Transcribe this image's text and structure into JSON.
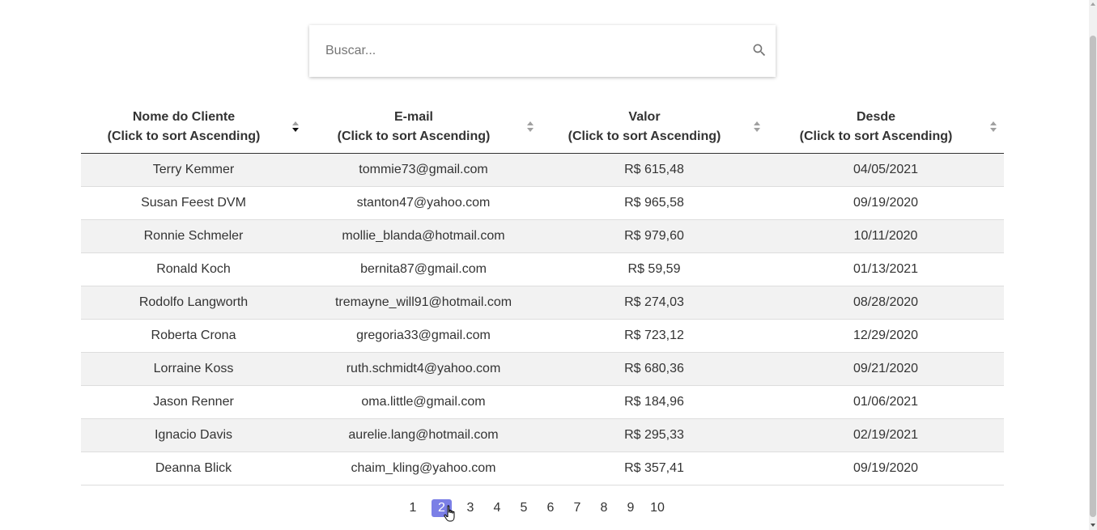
{
  "search": {
    "placeholder": "Buscar...",
    "icon": "search-icon"
  },
  "table": {
    "headers": [
      {
        "title": "Nome do Cliente",
        "hint": "(Click to sort Ascending)",
        "sort_state": "descending"
      },
      {
        "title": "E-mail",
        "hint": "(Click to sort Ascending)",
        "sort_state": "none"
      },
      {
        "title": "Valor",
        "hint": "(Click to sort Ascending)",
        "sort_state": "none"
      },
      {
        "title": "Desde",
        "hint": "(Click to sort Ascending)",
        "sort_state": "none"
      }
    ],
    "rows": [
      [
        "Terry Kemmer",
        "tommie73@gmail.com",
        "R$ 615,48",
        "04/05/2021"
      ],
      [
        "Susan Feest DVM",
        "stanton47@yahoo.com",
        "R$ 965,58",
        "09/19/2020"
      ],
      [
        "Ronnie Schmeler",
        "mollie_blanda@hotmail.com",
        "R$ 979,60",
        "10/11/2020"
      ],
      [
        "Ronald Koch",
        "bernita87@gmail.com",
        "R$ 59,59",
        "01/13/2021"
      ],
      [
        "Rodolfo Langworth",
        "tremayne_will91@hotmail.com",
        "R$ 274,03",
        "08/28/2020"
      ],
      [
        "Roberta Crona",
        "gregoria33@gmail.com",
        "R$ 723,12",
        "12/29/2020"
      ],
      [
        "Lorraine Koss",
        "ruth.schmidt4@yahoo.com",
        "R$ 680,36",
        "09/21/2020"
      ],
      [
        "Jason Renner",
        "oma.little@gmail.com",
        "R$ 184,96",
        "01/06/2021"
      ],
      [
        "Ignacio Davis",
        "aurelie.lang@hotmail.com",
        "R$ 295,33",
        "02/19/2021"
      ],
      [
        "Deanna Blick",
        "chaim_kling@yahoo.com",
        "R$ 357,41",
        "09/19/2020"
      ]
    ]
  },
  "pagination": {
    "pages": [
      "1",
      "2",
      "3",
      "4",
      "5",
      "6",
      "7",
      "8",
      "9",
      "10"
    ],
    "current": "2"
  },
  "colors": {
    "accent": "#7b7fe6",
    "row_stripe": "#f2f2f2",
    "text": "#333333"
  }
}
